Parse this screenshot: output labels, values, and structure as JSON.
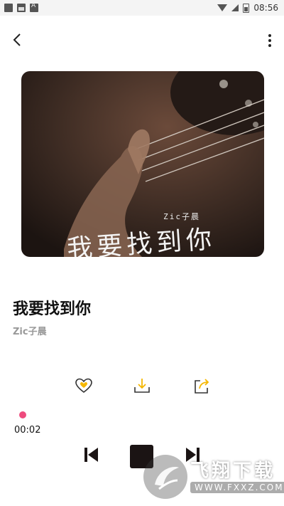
{
  "statusbar": {
    "time": "08:56"
  },
  "cover": {
    "artist_text": "Zic子晨",
    "title_text": "我要找到你"
  },
  "song": {
    "title": "我要找到你",
    "artist": "Zic子晨"
  },
  "player": {
    "elapsed": "00:02",
    "accent_color": "#ee4b7e"
  },
  "watermark": {
    "text": "飞翔下载",
    "url": "WWW.FXXZ.COM"
  }
}
